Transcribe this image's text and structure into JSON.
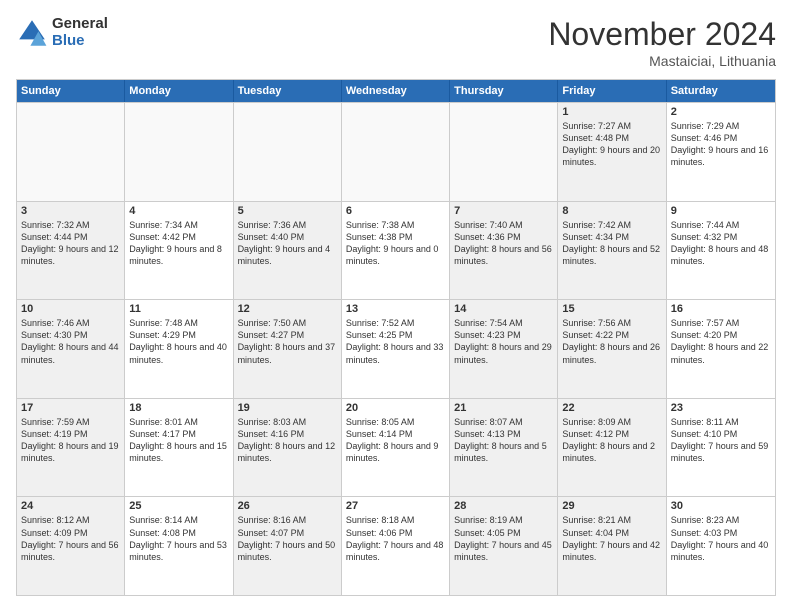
{
  "logo": {
    "general": "General",
    "blue": "Blue"
  },
  "title": "November 2024",
  "subtitle": "Mastaiciai, Lithuania",
  "header_days": [
    "Sunday",
    "Monday",
    "Tuesday",
    "Wednesday",
    "Thursday",
    "Friday",
    "Saturday"
  ],
  "rows": [
    [
      {
        "day": "",
        "text": "",
        "empty": true
      },
      {
        "day": "",
        "text": "",
        "empty": true
      },
      {
        "day": "",
        "text": "",
        "empty": true
      },
      {
        "day": "",
        "text": "",
        "empty": true
      },
      {
        "day": "",
        "text": "",
        "empty": true
      },
      {
        "day": "1",
        "text": "Sunrise: 7:27 AM\nSunset: 4:48 PM\nDaylight: 9 hours and 20 minutes.",
        "shaded": true
      },
      {
        "day": "2",
        "text": "Sunrise: 7:29 AM\nSunset: 4:46 PM\nDaylight: 9 hours and 16 minutes.",
        "shaded": false
      }
    ],
    [
      {
        "day": "3",
        "text": "Sunrise: 7:32 AM\nSunset: 4:44 PM\nDaylight: 9 hours and 12 minutes.",
        "shaded": true
      },
      {
        "day": "4",
        "text": "Sunrise: 7:34 AM\nSunset: 4:42 PM\nDaylight: 9 hours and 8 minutes.",
        "shaded": false
      },
      {
        "day": "5",
        "text": "Sunrise: 7:36 AM\nSunset: 4:40 PM\nDaylight: 9 hours and 4 minutes.",
        "shaded": true
      },
      {
        "day": "6",
        "text": "Sunrise: 7:38 AM\nSunset: 4:38 PM\nDaylight: 9 hours and 0 minutes.",
        "shaded": false
      },
      {
        "day": "7",
        "text": "Sunrise: 7:40 AM\nSunset: 4:36 PM\nDaylight: 8 hours and 56 minutes.",
        "shaded": true
      },
      {
        "day": "8",
        "text": "Sunrise: 7:42 AM\nSunset: 4:34 PM\nDaylight: 8 hours and 52 minutes.",
        "shaded": true
      },
      {
        "day": "9",
        "text": "Sunrise: 7:44 AM\nSunset: 4:32 PM\nDaylight: 8 hours and 48 minutes.",
        "shaded": false
      }
    ],
    [
      {
        "day": "10",
        "text": "Sunrise: 7:46 AM\nSunset: 4:30 PM\nDaylight: 8 hours and 44 minutes.",
        "shaded": true
      },
      {
        "day": "11",
        "text": "Sunrise: 7:48 AM\nSunset: 4:29 PM\nDaylight: 8 hours and 40 minutes.",
        "shaded": false
      },
      {
        "day": "12",
        "text": "Sunrise: 7:50 AM\nSunset: 4:27 PM\nDaylight: 8 hours and 37 minutes.",
        "shaded": true
      },
      {
        "day": "13",
        "text": "Sunrise: 7:52 AM\nSunset: 4:25 PM\nDaylight: 8 hours and 33 minutes.",
        "shaded": false
      },
      {
        "day": "14",
        "text": "Sunrise: 7:54 AM\nSunset: 4:23 PM\nDaylight: 8 hours and 29 minutes.",
        "shaded": true
      },
      {
        "day": "15",
        "text": "Sunrise: 7:56 AM\nSunset: 4:22 PM\nDaylight: 8 hours and 26 minutes.",
        "shaded": true
      },
      {
        "day": "16",
        "text": "Sunrise: 7:57 AM\nSunset: 4:20 PM\nDaylight: 8 hours and 22 minutes.",
        "shaded": false
      }
    ],
    [
      {
        "day": "17",
        "text": "Sunrise: 7:59 AM\nSunset: 4:19 PM\nDaylight: 8 hours and 19 minutes.",
        "shaded": true
      },
      {
        "day": "18",
        "text": "Sunrise: 8:01 AM\nSunset: 4:17 PM\nDaylight: 8 hours and 15 minutes.",
        "shaded": false
      },
      {
        "day": "19",
        "text": "Sunrise: 8:03 AM\nSunset: 4:16 PM\nDaylight: 8 hours and 12 minutes.",
        "shaded": true
      },
      {
        "day": "20",
        "text": "Sunrise: 8:05 AM\nSunset: 4:14 PM\nDaylight: 8 hours and 9 minutes.",
        "shaded": false
      },
      {
        "day": "21",
        "text": "Sunrise: 8:07 AM\nSunset: 4:13 PM\nDaylight: 8 hours and 5 minutes.",
        "shaded": true
      },
      {
        "day": "22",
        "text": "Sunrise: 8:09 AM\nSunset: 4:12 PM\nDaylight: 8 hours and 2 minutes.",
        "shaded": true
      },
      {
        "day": "23",
        "text": "Sunrise: 8:11 AM\nSunset: 4:10 PM\nDaylight: 7 hours and 59 minutes.",
        "shaded": false
      }
    ],
    [
      {
        "day": "24",
        "text": "Sunrise: 8:12 AM\nSunset: 4:09 PM\nDaylight: 7 hours and 56 minutes.",
        "shaded": true
      },
      {
        "day": "25",
        "text": "Sunrise: 8:14 AM\nSunset: 4:08 PM\nDaylight: 7 hours and 53 minutes.",
        "shaded": false
      },
      {
        "day": "26",
        "text": "Sunrise: 8:16 AM\nSunset: 4:07 PM\nDaylight: 7 hours and 50 minutes.",
        "shaded": true
      },
      {
        "day": "27",
        "text": "Sunrise: 8:18 AM\nSunset: 4:06 PM\nDaylight: 7 hours and 48 minutes.",
        "shaded": false
      },
      {
        "day": "28",
        "text": "Sunrise: 8:19 AM\nSunset: 4:05 PM\nDaylight: 7 hours and 45 minutes.",
        "shaded": true
      },
      {
        "day": "29",
        "text": "Sunrise: 8:21 AM\nSunset: 4:04 PM\nDaylight: 7 hours and 42 minutes.",
        "shaded": true
      },
      {
        "day": "30",
        "text": "Sunrise: 8:23 AM\nSunset: 4:03 PM\nDaylight: 7 hours and 40 minutes.",
        "shaded": false
      }
    ]
  ]
}
